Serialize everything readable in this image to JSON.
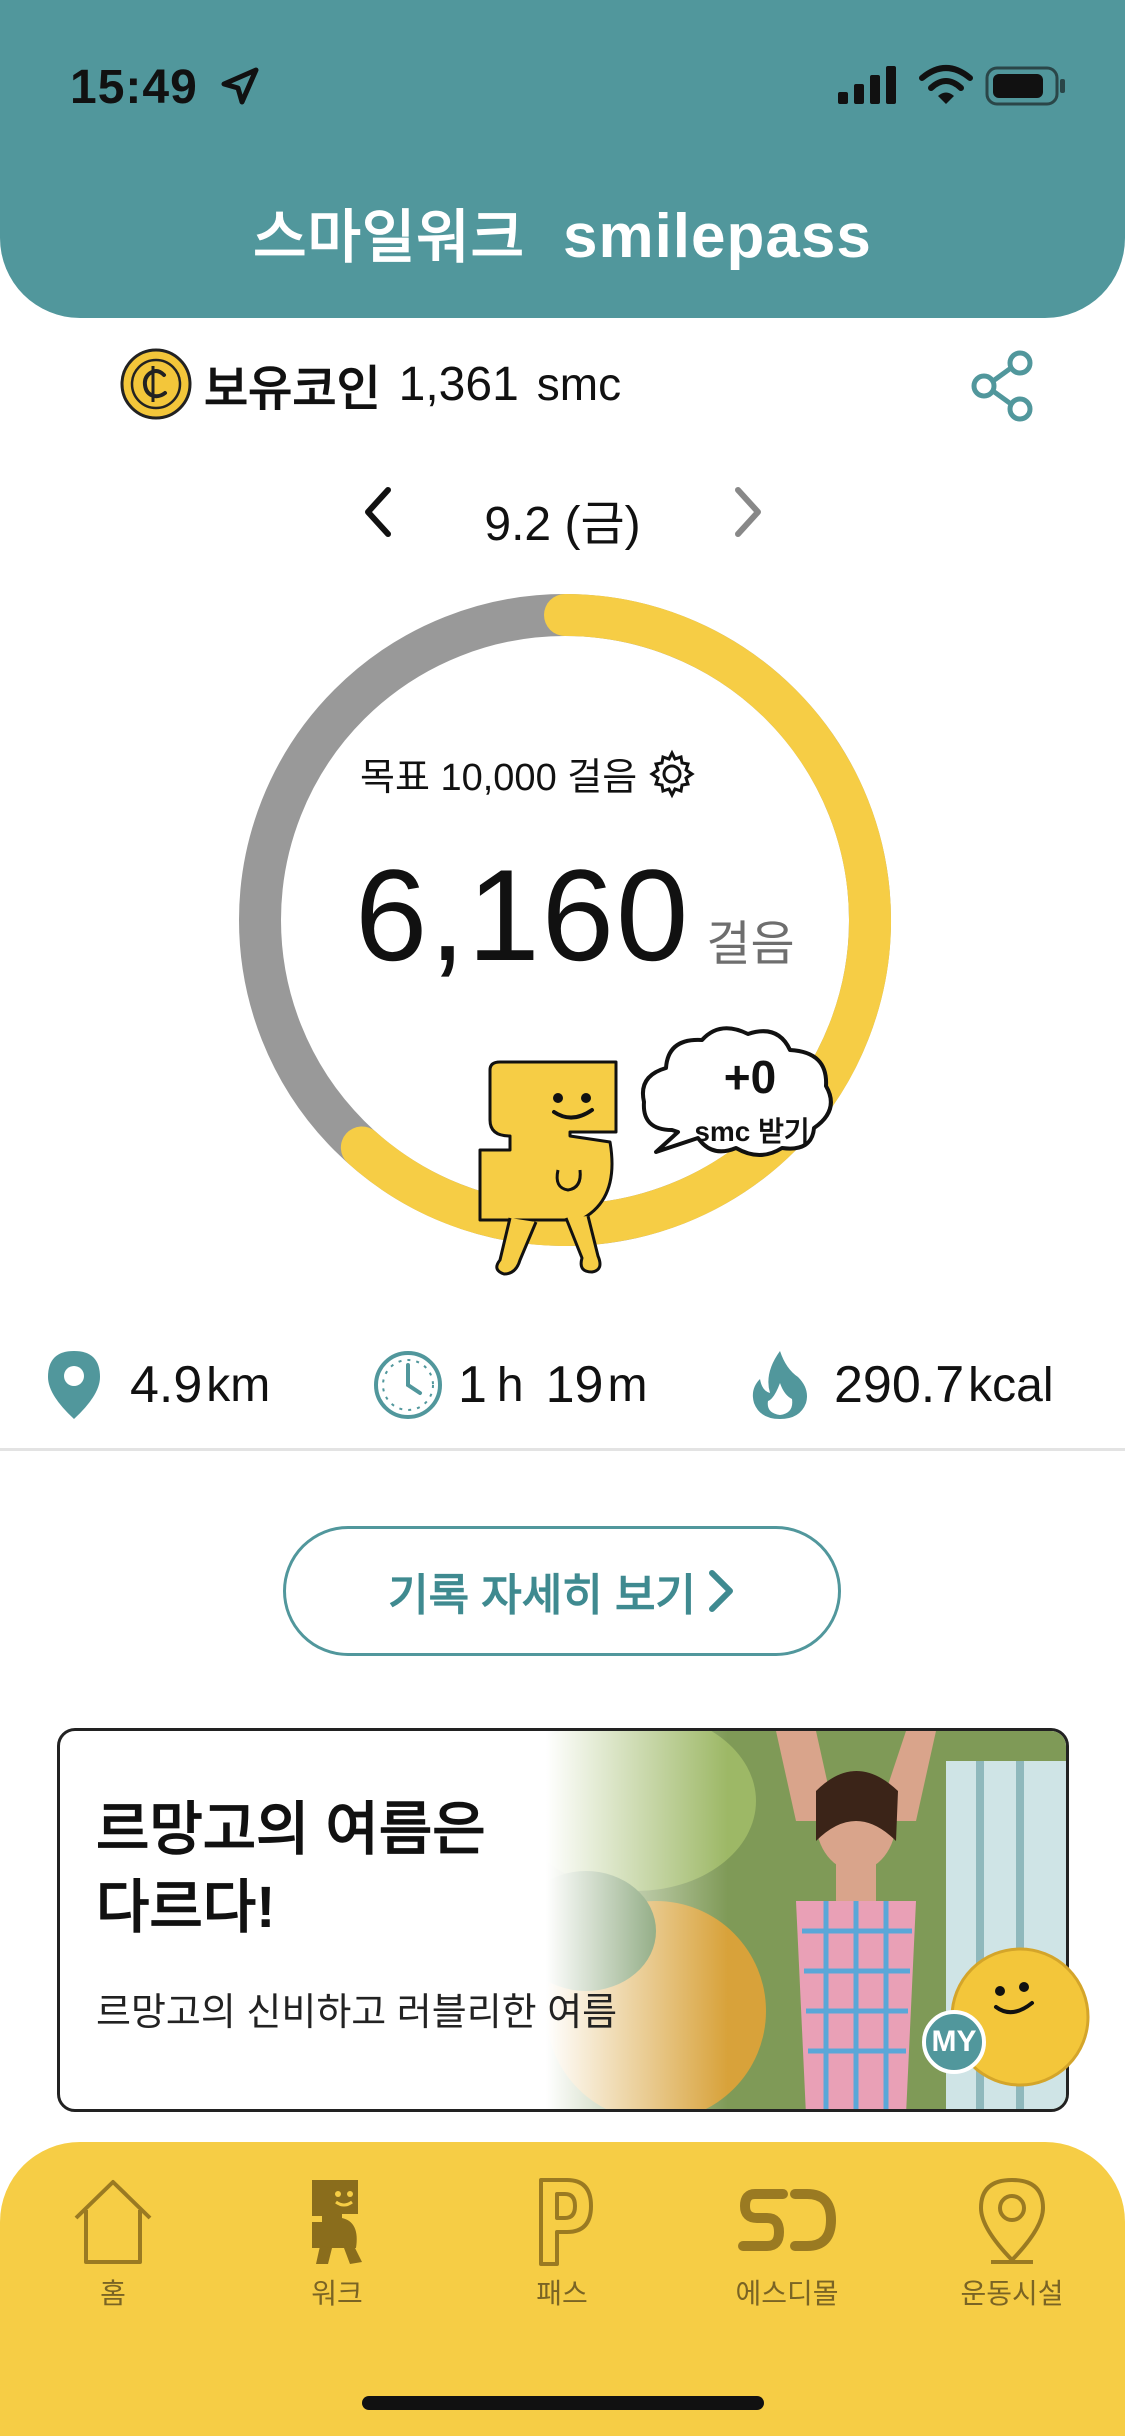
{
  "status_bar": {
    "time": "15:49"
  },
  "header": {
    "title_ko": "스마일워크",
    "title_en": "smilepass"
  },
  "coin": {
    "label": "보유코인",
    "value": "1,361",
    "unit": "smc"
  },
  "date": {
    "text": "9.2 (금)"
  },
  "goal": {
    "text": "목표 10,000 걸음"
  },
  "steps": {
    "count": "6,160",
    "unit": "걸음",
    "progress_fraction": 0.616
  },
  "reward": {
    "amount": "+0",
    "label": "smc 받기"
  },
  "stats": {
    "distance": {
      "value": "4.9",
      "unit": "km"
    },
    "duration": {
      "h": "1",
      "h_unit": "h",
      "m": "19",
      "m_unit": "m"
    },
    "calories": {
      "value": "290.7",
      "unit": "kcal"
    }
  },
  "detail_button": {
    "label": "기록 자세히 보기"
  },
  "ad": {
    "title": "르망고의 여름은 다르다!",
    "subtitle": "르망고의 신비하고 러블리한 여름",
    "badge": "MY"
  },
  "nav": [
    {
      "label": "홈",
      "icon": "home-icon"
    },
    {
      "label": "워크",
      "icon": "walk-mascot-icon"
    },
    {
      "label": "패스",
      "icon": "pass-p-icon"
    },
    {
      "label": "에스디몰",
      "icon": "sd-mall-icon"
    },
    {
      "label": "운동시설",
      "icon": "location-pin-icon"
    }
  ],
  "colors": {
    "teal": "#51979c",
    "yellow": "#f6cd45",
    "ring_gray": "#999999"
  }
}
